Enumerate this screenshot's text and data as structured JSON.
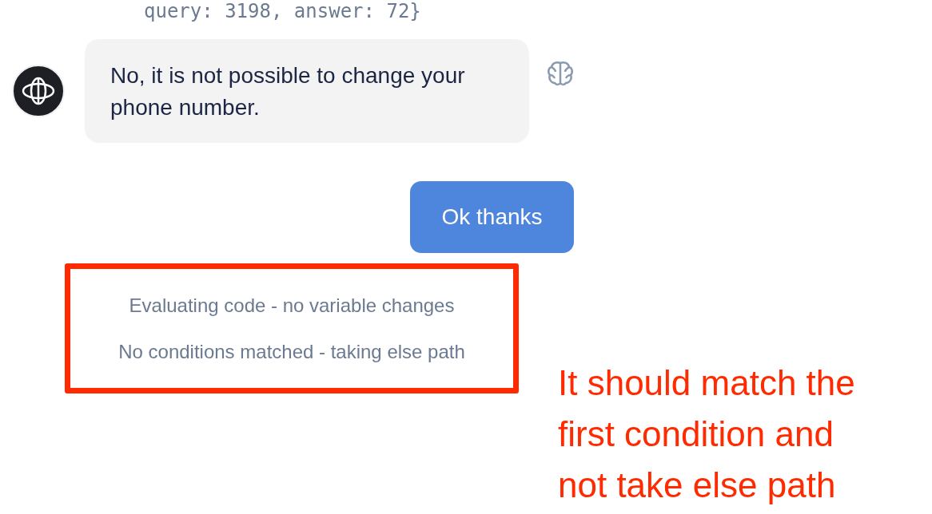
{
  "code_line": "query: 3198, answer: 72}",
  "messages": [
    {
      "kind": "bot",
      "text": "No, it is not possible to change your phone number."
    },
    {
      "kind": "user",
      "text": "Ok thanks"
    }
  ],
  "events": [
    "Evaluating code - no variable changes",
    "No conditions matched - taking else path"
  ],
  "annotation": {
    "text": "It should match the first condition and not take else path",
    "highlight_events": true
  }
}
